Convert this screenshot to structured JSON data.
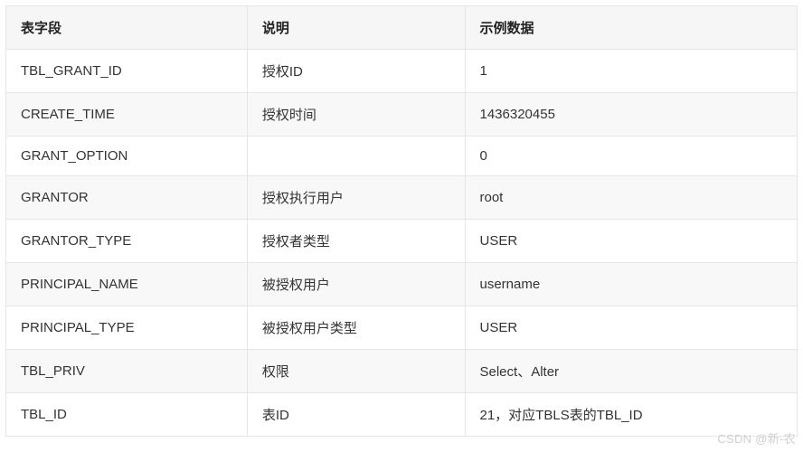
{
  "table": {
    "headers": {
      "field": "表字段",
      "desc": "说明",
      "example": "示例数据"
    },
    "rows": [
      {
        "field": "TBL_GRANT_ID",
        "desc": "授权ID",
        "example": "1"
      },
      {
        "field": "CREATE_TIME",
        "desc": "授权时间",
        "example": "1436320455"
      },
      {
        "field": "GRANT_OPTION",
        "desc": "",
        "example": "0"
      },
      {
        "field": "GRANTOR",
        "desc": "授权执行用户",
        "example": "root"
      },
      {
        "field": "GRANTOR_TYPE",
        "desc": "授权者类型",
        "example": "USER"
      },
      {
        "field": "PRINCIPAL_NAME",
        "desc": "被授权用户",
        "example": "username"
      },
      {
        "field": "PRINCIPAL_TYPE",
        "desc": "被授权用户类型",
        "example": "USER"
      },
      {
        "field": "TBL_PRIV",
        "desc": "权限",
        "example": "Select、Alter"
      },
      {
        "field": "TBL_ID",
        "desc": "表ID",
        "example": "21，对应TBLS表的TBL_ID"
      }
    ]
  },
  "watermark": "CSDN @新-农"
}
